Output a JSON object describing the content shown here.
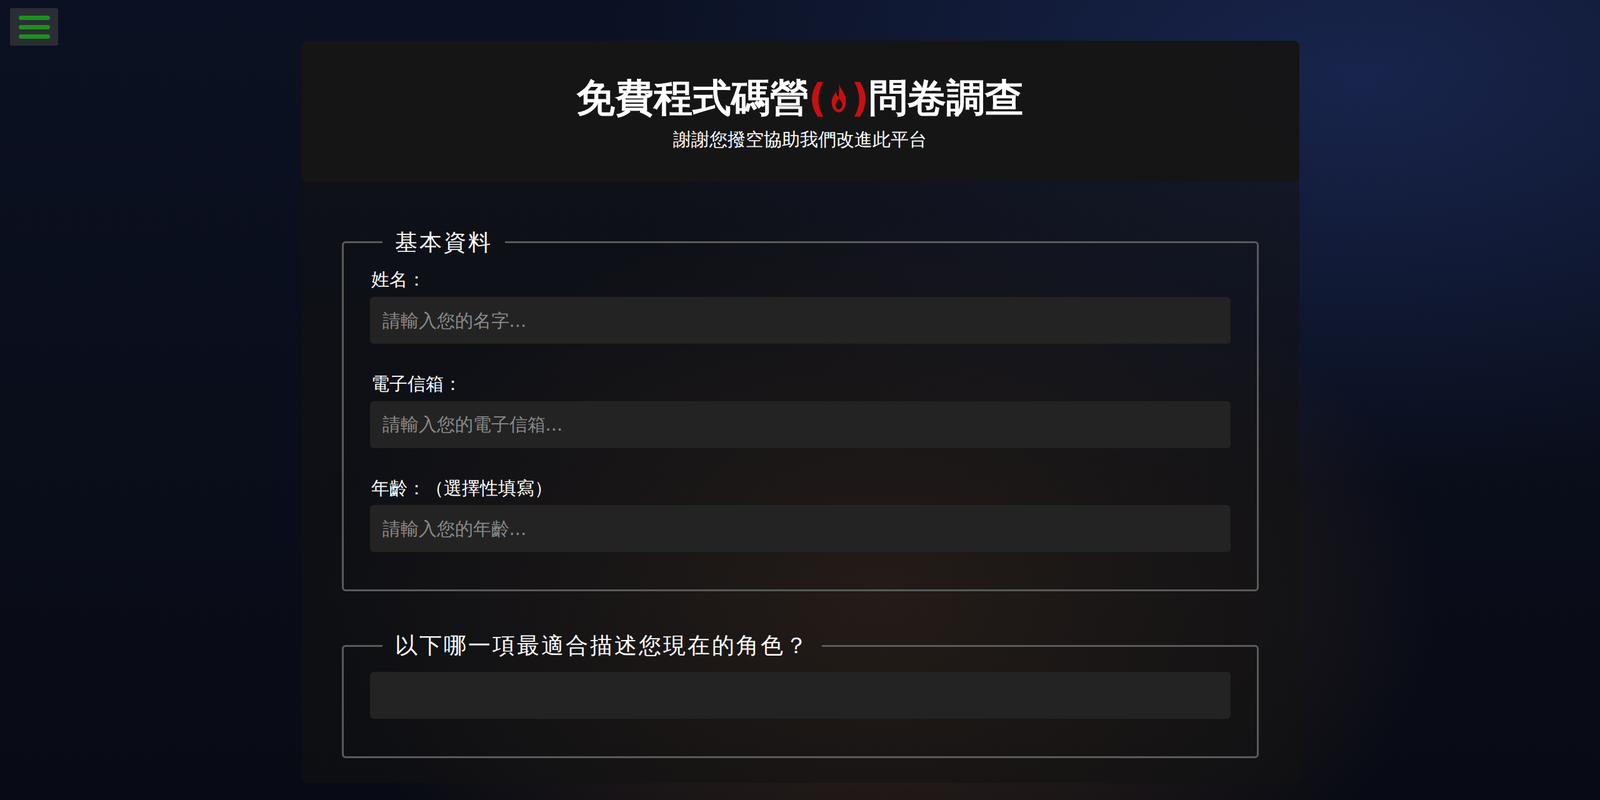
{
  "title": {
    "before": "免費程式碼營",
    "open": "(",
    "close": ")",
    "after": "問卷調查"
  },
  "subtitle": "謝謝您撥空協助我們改進此平台",
  "sections": [
    {
      "legend": "基本資料",
      "fields": [
        {
          "kind": "text",
          "label": "姓名：",
          "placeholder": "請輸入您的名字..."
        },
        {
          "kind": "text",
          "label": "電子信箱：",
          "placeholder": "請輸入您的電子信箱..."
        },
        {
          "kind": "text",
          "label": "年齡：（選擇性填寫）",
          "placeholder": "請輸入您的年齡..."
        }
      ]
    },
    {
      "legend": "以下哪一項最適合描述您現在的角色？",
      "fields": [
        {
          "kind": "select",
          "label": "",
          "placeholder": ""
        }
      ]
    }
  ]
}
